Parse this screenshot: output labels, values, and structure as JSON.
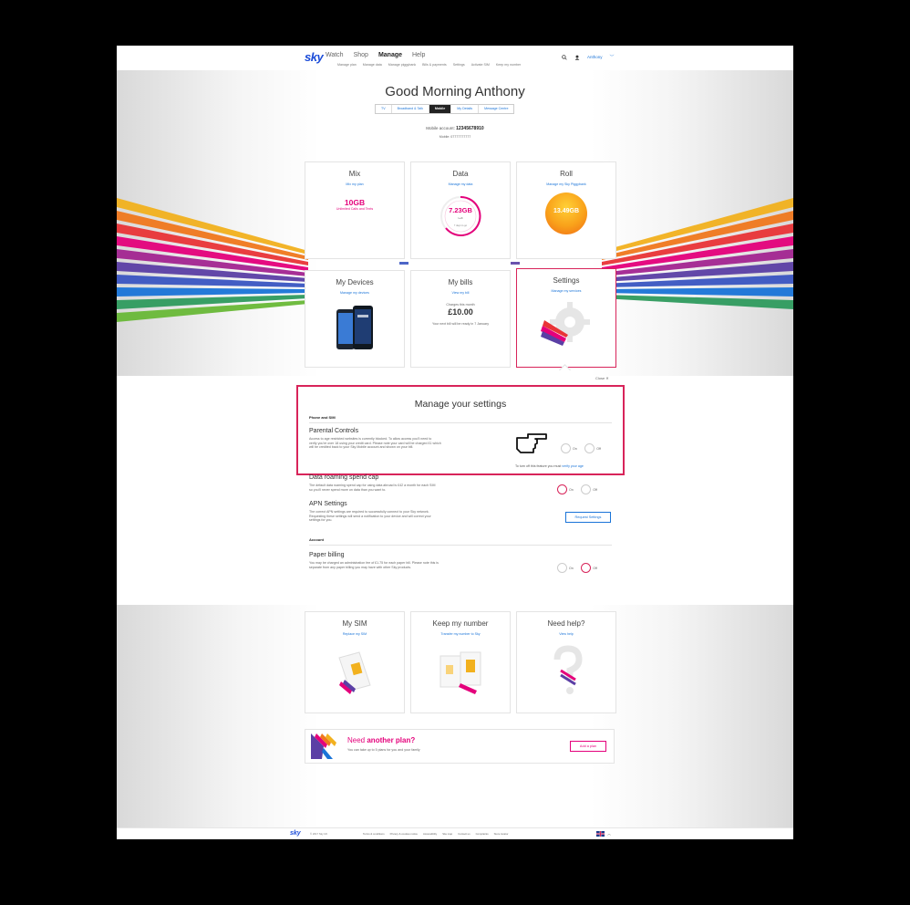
{
  "header": {
    "logo": "sky",
    "nav": [
      "Watch",
      "Shop",
      "Manage",
      "Help"
    ],
    "active_nav": "Manage",
    "subnav": [
      "Manage plan",
      "Manage data",
      "Manage piggybank",
      "Bills & payments",
      "Settings",
      "Activate SIM",
      "Keep my number"
    ],
    "user": "Anthony"
  },
  "hero": {
    "greeting": "Good Morning Anthony",
    "tabs": [
      "TV",
      "Broadband & Talk",
      "Mobile",
      "My Details",
      "Message Centre"
    ],
    "selected_tab": "Mobile",
    "account_label": "Mobile account:",
    "account_number": "12345678910",
    "mobile_line": "Mobile: 07777777777"
  },
  "cards_top": [
    {
      "title": "Mix",
      "link": "Mix my plan",
      "big": "10GB",
      "sub": "Unlimited Calls and Texts"
    },
    {
      "title": "Data",
      "link": "Manage my data",
      "big": "7.23GB",
      "sub": "Left",
      "sub2": "7 days to go"
    },
    {
      "title": "Roll",
      "link": "Manage my Sky Piggybank",
      "big": "13.49GB"
    }
  ],
  "cards_mid": [
    {
      "title": "My Devices",
      "link": "Manage my devices"
    },
    {
      "title": "My bills",
      "link": "View my bill",
      "sub": "Charges this month",
      "big": "£10.00",
      "note": "Your next bill will be ready in 7 January"
    },
    {
      "title": "Settings",
      "link": "Manage my services"
    }
  ],
  "settings": {
    "close": "Close",
    "title": "Manage your settings",
    "section1": "Phone and SIM",
    "parental": {
      "title": "Parental Controls",
      "desc1": "Access to age restricted websites is currently blocked. To allow access you'll need to",
      "desc2": "verify you're over 18 using your credit card. Please note your card will be charged £1 which",
      "desc3": "will be credited back to your Sky Mobile account and shown on your bill.",
      "footnote": "To turn off this feature you must",
      "footlink": "verify your age"
    },
    "roaming": {
      "title": "Data roaming spend cap",
      "desc1": "The default data roaming spend cap for using data abroad is £42 a month for each SIM",
      "desc2": "so you'll never spend more on data than you want to."
    },
    "apn": {
      "title": "APN Settings",
      "desc1": "The correct APN settings are required to successfully connect to your Sky network.",
      "desc2": "Requesting these settings will send a notification to your device and will correct your",
      "desc3": "settings for you.",
      "button": "Request Settings"
    },
    "section2": "Account",
    "paper": {
      "title": "Paper billing",
      "desc1": "You may be charged an administration fee of £1.75 for each paper bill. Please note this is",
      "desc2": "separate from any paper billing you may have with other Sky products."
    },
    "on": "On",
    "off": "Off"
  },
  "cards_bottom": [
    {
      "title": "My SIM",
      "link": "Replace my SIM"
    },
    {
      "title": "Keep my number",
      "link": "Transfer my number to Sky"
    },
    {
      "title": "Need help?",
      "link": "View help"
    }
  ],
  "plan_banner": {
    "title_a": "Need ",
    "title_b": "another plan?",
    "desc": "You can take up to 5 plans for you and your family",
    "button": "Add a plan"
  },
  "footer": {
    "logo": "sky",
    "copyright": "© 2017 Sky UK",
    "links": [
      "Terms & conditions",
      "Privacy & cookies notice",
      "Accessibility",
      "Site map",
      "Contact us",
      "Complaints",
      "Store locator"
    ]
  },
  "colors": {
    "accent": "#e4007b",
    "link": "#1a74d8",
    "highlight": "#d8245a"
  }
}
